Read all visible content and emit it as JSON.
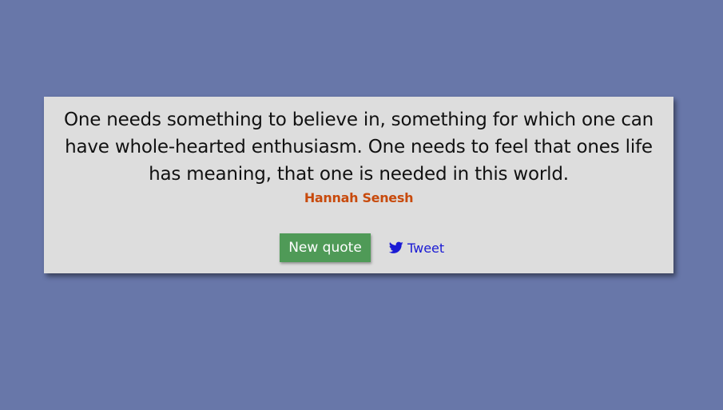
{
  "quote": {
    "text": "One needs something to believe in, something for which one can have whole-hearted enthusiasm. One needs to feel that ones life has meaning, that one is needed in this world.",
    "author": "Hannah Senesh"
  },
  "actions": {
    "new_quote_label": "New quote",
    "tweet_label": "Tweet",
    "tweet_icon": "twitter-bird-icon"
  },
  "colors": {
    "background": "#6877a9",
    "card": "#dddddd",
    "author": "#c84a0c",
    "button": "#4f9a57",
    "link": "#1a1ad4"
  }
}
